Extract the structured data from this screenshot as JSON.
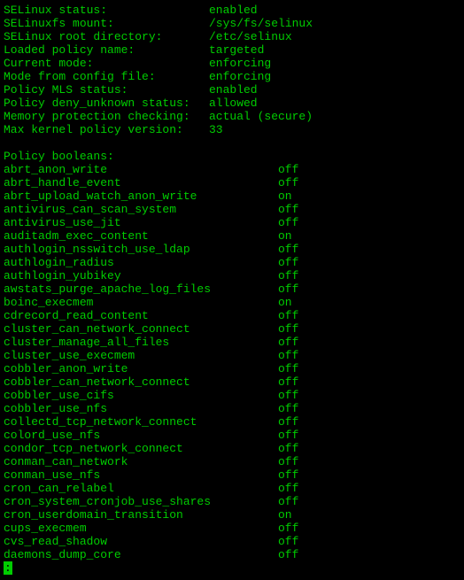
{
  "status": [
    {
      "label": "SELinux status:",
      "value": "enabled"
    },
    {
      "label": "SELinuxfs mount:",
      "value": "/sys/fs/selinux"
    },
    {
      "label": "SELinux root directory:",
      "value": "/etc/selinux"
    },
    {
      "label": "Loaded policy name:",
      "value": "targeted"
    },
    {
      "label": "Current mode:",
      "value": "enforcing"
    },
    {
      "label": "Mode from config file:",
      "value": "enforcing"
    },
    {
      "label": "Policy MLS status:",
      "value": "enabled"
    },
    {
      "label": "Policy deny_unknown status:",
      "value": "allowed"
    },
    {
      "label": "Memory protection checking:",
      "value": "actual (secure)"
    },
    {
      "label": "Max kernel policy version:",
      "value": "33"
    }
  ],
  "section_header": "Policy booleans:",
  "booleans": [
    {
      "name": "abrt_anon_write",
      "value": "off"
    },
    {
      "name": "abrt_handle_event",
      "value": "off"
    },
    {
      "name": "abrt_upload_watch_anon_write",
      "value": "on"
    },
    {
      "name": "antivirus_can_scan_system",
      "value": "off"
    },
    {
      "name": "antivirus_use_jit",
      "value": "off"
    },
    {
      "name": "auditadm_exec_content",
      "value": "on"
    },
    {
      "name": "authlogin_nsswitch_use_ldap",
      "value": "off"
    },
    {
      "name": "authlogin_radius",
      "value": "off"
    },
    {
      "name": "authlogin_yubikey",
      "value": "off"
    },
    {
      "name": "awstats_purge_apache_log_files",
      "value": "off"
    },
    {
      "name": "boinc_execmem",
      "value": "on"
    },
    {
      "name": "cdrecord_read_content",
      "value": "off"
    },
    {
      "name": "cluster_can_network_connect",
      "value": "off"
    },
    {
      "name": "cluster_manage_all_files",
      "value": "off"
    },
    {
      "name": "cluster_use_execmem",
      "value": "off"
    },
    {
      "name": "cobbler_anon_write",
      "value": "off"
    },
    {
      "name": "cobbler_can_network_connect",
      "value": "off"
    },
    {
      "name": "cobbler_use_cifs",
      "value": "off"
    },
    {
      "name": "cobbler_use_nfs",
      "value": "off"
    },
    {
      "name": "collectd_tcp_network_connect",
      "value": "off"
    },
    {
      "name": "colord_use_nfs",
      "value": "off"
    },
    {
      "name": "condor_tcp_network_connect",
      "value": "off"
    },
    {
      "name": "conman_can_network",
      "value": "off"
    },
    {
      "name": "conman_use_nfs",
      "value": "off"
    },
    {
      "name": "cron_can_relabel",
      "value": "off"
    },
    {
      "name": "cron_system_cronjob_use_shares",
      "value": "off"
    },
    {
      "name": "cron_userdomain_transition",
      "value": "on"
    },
    {
      "name": "cups_execmem",
      "value": "off"
    },
    {
      "name": "cvs_read_shadow",
      "value": "off"
    },
    {
      "name": "daemons_dump_core",
      "value": "off"
    }
  ],
  "prompt": ":"
}
